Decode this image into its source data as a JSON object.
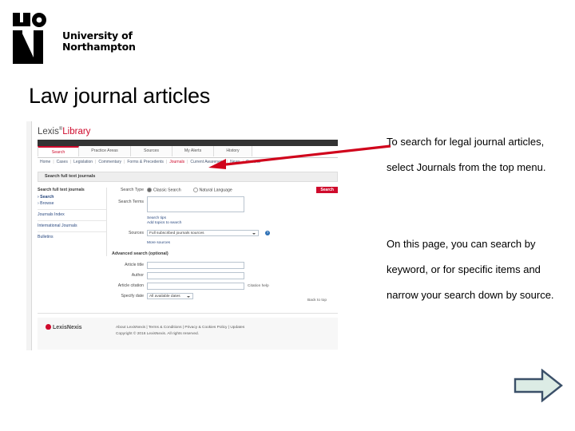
{
  "slide": {
    "title": "Law journal articles"
  },
  "logo": {
    "mark": "UON",
    "line1": "University of",
    "line2": "Northampton"
  },
  "screenshot": {
    "brand": {
      "lexis": "Lexis",
      "sup": "®",
      "library": "Library"
    },
    "tabs": [
      {
        "label": "Search",
        "active": true
      },
      {
        "label": "Practice Areas",
        "active": false
      },
      {
        "label": "Sources",
        "active": false
      },
      {
        "label": "My Alerts",
        "active": false
      },
      {
        "label": "History",
        "active": false
      }
    ],
    "subnav": [
      {
        "label": "Home",
        "selected": false
      },
      {
        "label": "Cases",
        "selected": false
      },
      {
        "label": "Legislation",
        "selected": false
      },
      {
        "label": "Commentary",
        "selected": false
      },
      {
        "label": "Forms & Precedents",
        "selected": false
      },
      {
        "label": "Journals",
        "selected": true
      },
      {
        "label": "Current Awareness",
        "selected": false
      },
      {
        "label": "News",
        "selected": false
      },
      {
        "label": "General",
        "selected": false
      }
    ],
    "section_bar": "Search full text journals",
    "sidebar": {
      "heading": "Search full text journals",
      "links": [
        "Search",
        "Browse"
      ],
      "groups": [
        "Journals Index",
        "International Journals",
        "Bulletins"
      ]
    },
    "form": {
      "search_type_label": "Search Type",
      "radio_classic": "Classic Search",
      "radio_natural": "Natural Language",
      "search_button": "Search",
      "search_terms_label": "Search Terms",
      "search_terms_value": "",
      "tips_link": "Search tips",
      "add_topics_link": "Add topics to search",
      "sources_label": "Sources",
      "sources_value": "Full subscribed journals sources",
      "more_sources_link": "More sources",
      "advanced_title": "Advanced search (optional)",
      "article_title_label": "Article title",
      "article_title_value": "",
      "author_label": "Author",
      "author_value": "",
      "article_citation_label": "Article citation",
      "article_citation_value": "",
      "citation_help_link": "Citation help",
      "specify_date_label": "Specify date",
      "specify_date_value": "All available dates"
    },
    "back_to_top": "Back to top",
    "footer": {
      "logo": "LexisNexis",
      "links": "About LexisNexis | Terms & Conditions | Privacy & Cookies Policy | Updates",
      "copyright": "Copyright © 2016 LexisNexis. All rights reserved."
    }
  },
  "callouts": {
    "top": "To search for legal journal articles, select Journals from the top menu.",
    "bottom": "On this page, you can search by keyword, or for specific items and narrow your search down by source."
  },
  "colors": {
    "brand_red": "#cf0a2c",
    "annotation_red": "#d0021b",
    "arrow_outline": "#3b5069",
    "arrow_fill": "#dcece5",
    "dark_bar": "#333333"
  }
}
